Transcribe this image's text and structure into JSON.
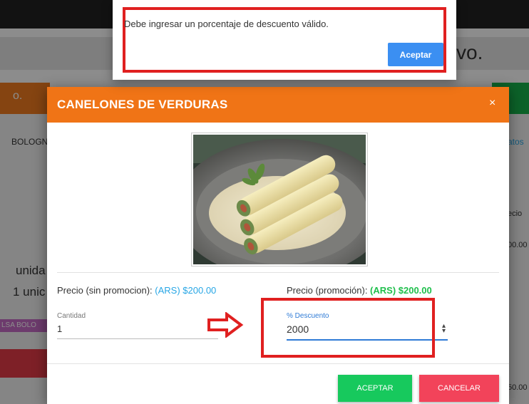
{
  "background": {
    "subbar_text": "vo.",
    "left_tab_text": "o.",
    "left_item_text": "BOLOGN",
    "right_link_text": "atos",
    "left_units_1": "unida",
    "left_units_2": "1 unic",
    "left_tag_text": "LSA BOLO",
    "right_col_header": "ecio",
    "right_price_1": "00.00",
    "right_price_2": "50.00"
  },
  "alert": {
    "message": "Debe ingresar un porcentaje de descuento válido.",
    "accept_label": "Aceptar"
  },
  "modal": {
    "title": "CANELONES DE VERDURAS",
    "close_symbol": "×",
    "product_image": "canelones-dish-photo",
    "price_without_promo_label": "Precio (sin promocion): ",
    "price_without_promo_value": "(ARS) $200.00",
    "price_promo_label": "Precio (promoción): ",
    "price_promo_value": "(ARS) $200.00",
    "quantity": {
      "label": "Cantidad",
      "value": "1"
    },
    "discount": {
      "label": "% Descuento",
      "value": "2000"
    },
    "accept_label": "ACEPTAR",
    "cancel_label": "CANCELAR"
  },
  "colors": {
    "header_orange": "#f07416",
    "accept_green": "#17c95d",
    "cancel_red": "#f2435a",
    "alert_blue": "#3b8ff2",
    "annotation_red": "#e02020"
  },
  "icons": [
    "close-icon",
    "stepper-icon",
    "arrow-right-icon"
  ]
}
